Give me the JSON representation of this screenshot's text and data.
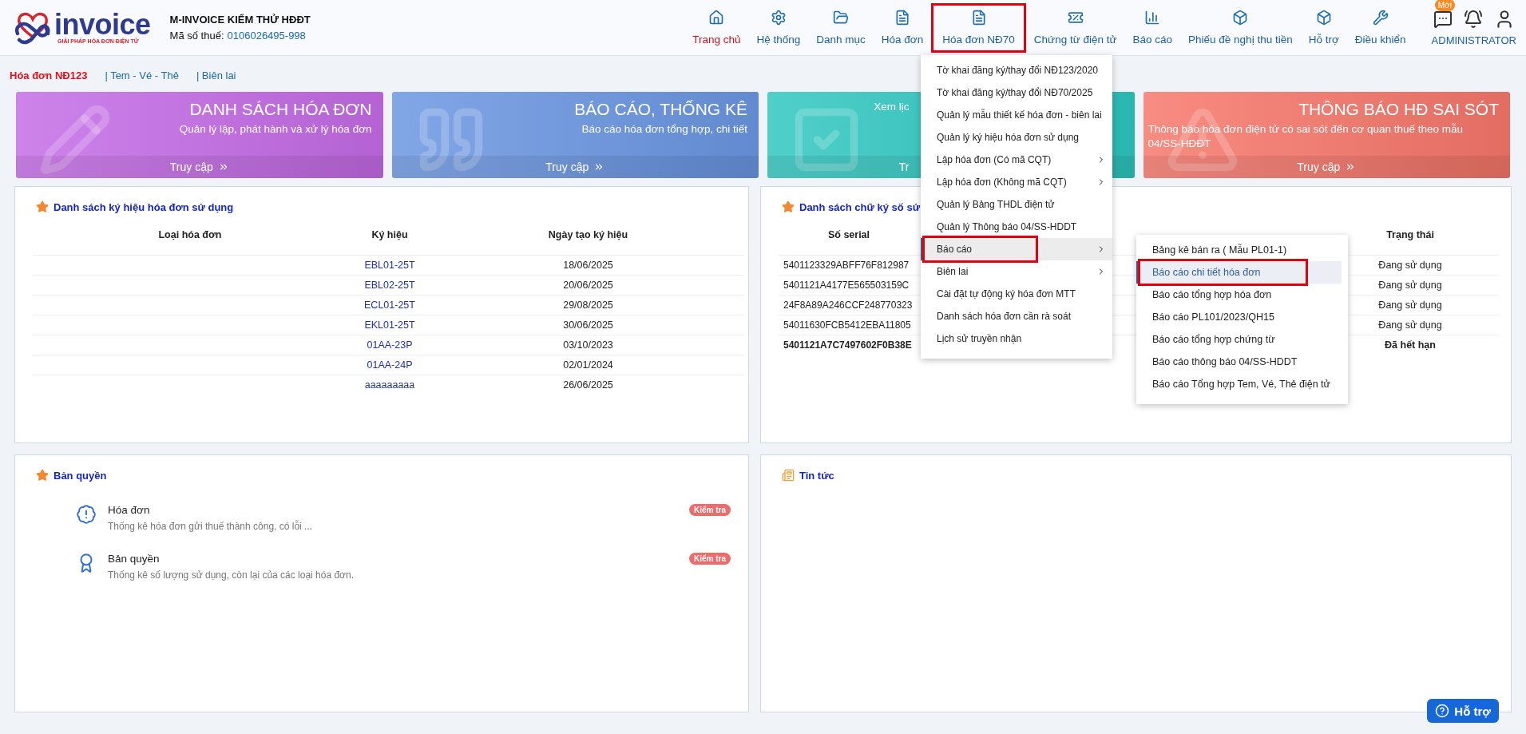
{
  "logo": {
    "name": "invoice",
    "tagline": "GIẢI PHÁP HÓA ĐƠN ĐIỆN TỬ"
  },
  "company": {
    "name": "M-INVOICE KIỂM THỬ HĐĐT",
    "tax_label": "Mã số thuế:",
    "tax_code": "0106026495-998"
  },
  "nav": [
    {
      "label": "Trang chủ",
      "selected": true,
      "highlighted": false
    },
    {
      "label": "Hệ thống",
      "selected": false,
      "highlighted": false
    },
    {
      "label": "Danh mục",
      "selected": false,
      "highlighted": false
    },
    {
      "label": "Hóa đơn",
      "selected": false,
      "highlighted": false
    },
    {
      "label": "Hóa đơn NĐ70",
      "selected": false,
      "highlighted": true
    },
    {
      "label": "Chứng từ điện tử",
      "selected": false,
      "highlighted": false
    },
    {
      "label": "Báo cáo",
      "selected": false,
      "highlighted": false
    },
    {
      "label": "Phiếu đề nghị thu tiền",
      "selected": false,
      "highlighted": false
    },
    {
      "label": "Hỗ trợ",
      "selected": false,
      "highlighted": false
    },
    {
      "label": "Điều khiển",
      "selected": false,
      "highlighted": false
    }
  ],
  "user_tools": {
    "chat_badge": "Mới",
    "user": "ADMINISTRATOR"
  },
  "subnav": [
    {
      "label": "Hóa đơn NĐ123",
      "selected": true
    },
    {
      "label": "| Tem - Vé - Thẻ",
      "selected": false
    },
    {
      "label": "| Biên lai",
      "selected": false
    }
  ],
  "cards": [
    {
      "kind": "pencil",
      "title": "DANH SÁCH HÓA ĐƠN",
      "description": "Quản lý lập, phát hành và xử lý hóa đơn",
      "link": "Truy cập",
      "color": "#c46be6"
    },
    {
      "kind": "quote",
      "title": "BÁO CÁO, THỐNG KÊ",
      "description": "Báo cáo hóa đơn tổng hợp, chi tiết",
      "link": "Truy cập",
      "color": "#6a96e2"
    },
    {
      "kind": "check",
      "description": "Xem lịc",
      "link": "Tr",
      "color": "#2ec6c0"
    },
    {
      "kind": "warning",
      "title": "THÔNG BÁO HĐ SAI SÓT",
      "description": "Thông báo hóa đơn điện tử có sai sót đến cơ quan thuế theo mẫu 04/SS-HĐĐT",
      "link": "Truy cập",
      "color": "#f7766a"
    }
  ],
  "symbols_panel": {
    "title": "Danh sách ký hiệu hóa đơn sử dụng",
    "columns": [
      "Loại hóa đơn",
      "Ký hiệu",
      "Ngày tạo ký hiệu"
    ],
    "rows": [
      {
        "symbol": "EBL01-25T",
        "created": "18/06/2025"
      },
      {
        "symbol": "EBL02-25T",
        "created": "20/06/2025"
      },
      {
        "symbol": "ECL01-25T",
        "created": "29/08/2025"
      },
      {
        "symbol": "EKL01-25T",
        "created": "30/06/2025"
      },
      {
        "symbol": "01AA-23P",
        "created": "03/10/2023"
      },
      {
        "symbol": "01AA-24P",
        "created": "02/01/2024"
      },
      {
        "symbol": "aaaaaaaaa",
        "created": "26/06/2025"
      }
    ]
  },
  "signatures_panel": {
    "title": "Danh sách chữ ký số sử",
    "columns": [
      "Số serial",
      "Trạng thái"
    ],
    "rows": [
      {
        "serial": "5401123329ABFF76F812987",
        "status": "Đang sử dụng",
        "expired": false
      },
      {
        "serial": "5401121A4177E565503159C",
        "status": "Đang sử dụng",
        "expired": false
      },
      {
        "serial": "24F8A89A246CCF248770323",
        "status": "Đang sử dụng",
        "expired": false
      },
      {
        "serial": "54011630FCB5412EBA11805",
        "status": "Đang sử dụng",
        "expired": false
      },
      {
        "serial": "5401121A7C7497602F0B38E",
        "status": "Đã hết hạn",
        "expired": true
      }
    ]
  },
  "menu": [
    {
      "label": "Tờ khai đăng ký/thay đổi NĐ123/2020",
      "has_submenu": false,
      "selected": false,
      "highlighted": false
    },
    {
      "label": "Tờ khai đăng ký/thay đổi NĐ70/2025",
      "has_submenu": false,
      "selected": false,
      "highlighted": false
    },
    {
      "label": "Quản lý mẫu thiết kế hóa đơn - biên lai",
      "has_submenu": false,
      "selected": false,
      "highlighted": false
    },
    {
      "label": "Quản lý ký hiệu hóa đơn sử dụng",
      "has_submenu": false,
      "selected": false,
      "highlighted": false
    },
    {
      "label": "Lập hóa đơn (Có mã CQT)",
      "has_submenu": true,
      "selected": false,
      "highlighted": false
    },
    {
      "label": "Lập hóa đơn (Không mã CQT)",
      "has_submenu": true,
      "selected": false,
      "highlighted": false
    },
    {
      "label": "Quản lý Bảng THDL điện tử",
      "has_submenu": false,
      "selected": false,
      "highlighted": false
    },
    {
      "label": "Quản lý Thông báo 04/SS-HDDT",
      "has_submenu": false,
      "selected": false,
      "highlighted": false
    },
    {
      "label": "Báo cáo",
      "has_submenu": true,
      "selected": true,
      "highlighted": true
    },
    {
      "label": "Biên lai",
      "has_submenu": true,
      "selected": false,
      "highlighted": false
    },
    {
      "label": "Cài đặt tự động ký hóa đơn MTT",
      "has_submenu": false,
      "selected": false,
      "highlighted": false
    },
    {
      "label": "Danh sách hóa đơn cần rà soát",
      "has_submenu": false,
      "selected": false,
      "highlighted": false
    },
    {
      "label": "Lịch sử truyền nhận",
      "has_submenu": false,
      "selected": false,
      "highlighted": false
    }
  ],
  "submenu": [
    {
      "label": "Bảng kê bán ra ( Mẫu PL01-1)",
      "selected": false,
      "highlighted": false
    },
    {
      "label": "Báo cáo chi tiết hóa đơn",
      "selected": true,
      "highlighted": true
    },
    {
      "label": "Báo cáo tổng hợp hóa đơn",
      "selected": false,
      "highlighted": false
    },
    {
      "label": "Báo cáo PL101/2023/QH15",
      "selected": false,
      "highlighted": false
    },
    {
      "label": "Báo cáo tổng hợp chứng từ",
      "selected": false,
      "highlighted": false
    },
    {
      "label": "Báo cáo thông báo 04/SS-HDDT",
      "selected": false,
      "highlighted": false
    },
    {
      "label": "Báo cáo Tổng hợp Tem, Vé, Thẻ điện tử",
      "selected": false,
      "highlighted": false
    }
  ],
  "license_panel": {
    "title": "Bản quyền",
    "items": [
      {
        "kind": "alert",
        "title": "Hóa đơn",
        "description": "Thống kê hóa đơn gửi thuế thành công, có lỗi ...",
        "badge": "Kiểm tra"
      },
      {
        "kind": "award",
        "title": "Bản quyền",
        "description": "Thống kê số lượng sử dụng, còn lại của các loại hóa đơn.",
        "badge": "Kiểm tra"
      }
    ]
  },
  "news_panel": {
    "title": "Tin tức"
  },
  "help_button": "Hỗ trợ"
}
